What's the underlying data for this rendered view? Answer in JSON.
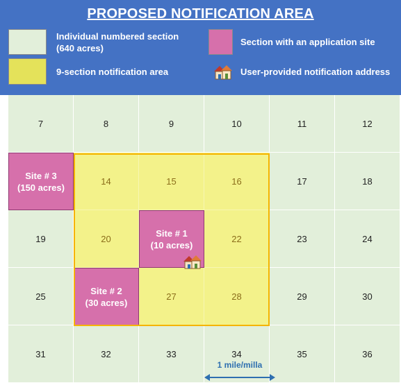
{
  "title": "PROPOSED NOTIFICATION AREA",
  "legend": {
    "individual_section": "Individual numbered section (640 acres)",
    "individual_section_line1": "Individual numbered section",
    "individual_section_line2": "(640 acres)",
    "application_site": "Section with an application site",
    "notification_area": "9-section notification area",
    "notification_address": "User-provided notification address",
    "icons": {
      "house": "house-icon"
    }
  },
  "grid": {
    "rows": [
      [
        {
          "label": "7",
          "kind": "plain"
        },
        {
          "label": "8",
          "kind": "plain"
        },
        {
          "label": "9",
          "kind": "plain"
        },
        {
          "label": "10",
          "kind": "plain"
        },
        {
          "label": "11",
          "kind": "plain"
        },
        {
          "label": "12",
          "kind": "plain"
        }
      ],
      [
        {
          "label": "Site # 3",
          "sub": "(150 acres)",
          "kind": "site"
        },
        {
          "label": "14",
          "kind": "notify"
        },
        {
          "label": "15",
          "kind": "notify"
        },
        {
          "label": "16",
          "kind": "notify"
        },
        {
          "label": "17",
          "kind": "plain"
        },
        {
          "label": "18",
          "kind": "plain"
        }
      ],
      [
        {
          "label": "19",
          "kind": "plain"
        },
        {
          "label": "20",
          "kind": "notify"
        },
        {
          "label": "Site # 1",
          "sub": "(10 acres)",
          "kind": "site"
        },
        {
          "label": "22",
          "kind": "notify"
        },
        {
          "label": "23",
          "kind": "plain"
        },
        {
          "label": "24",
          "kind": "plain"
        }
      ],
      [
        {
          "label": "25",
          "kind": "plain"
        },
        {
          "label": "Site # 2",
          "sub": "(30 acres)",
          "kind": "site"
        },
        {
          "label": "27",
          "kind": "notify"
        },
        {
          "label": "28",
          "kind": "notify"
        },
        {
          "label": "29",
          "kind": "plain"
        },
        {
          "label": "30",
          "kind": "plain"
        }
      ],
      [
        {
          "label": "31",
          "kind": "plain"
        },
        {
          "label": "32",
          "kind": "plain"
        },
        {
          "label": "33",
          "kind": "plain"
        },
        {
          "label": "34",
          "kind": "plain"
        },
        {
          "label": "35",
          "kind": "plain"
        },
        {
          "label": "36",
          "kind": "plain"
        }
      ]
    ]
  },
  "scale": {
    "label": "1 mile/milla"
  },
  "colors": {
    "header": "#4472c4",
    "section": "#e2efda",
    "notification_area": "#f3f28a",
    "notification_outline": "#f5b400",
    "site": "#d670ab",
    "scale": "#2e6fb0"
  }
}
